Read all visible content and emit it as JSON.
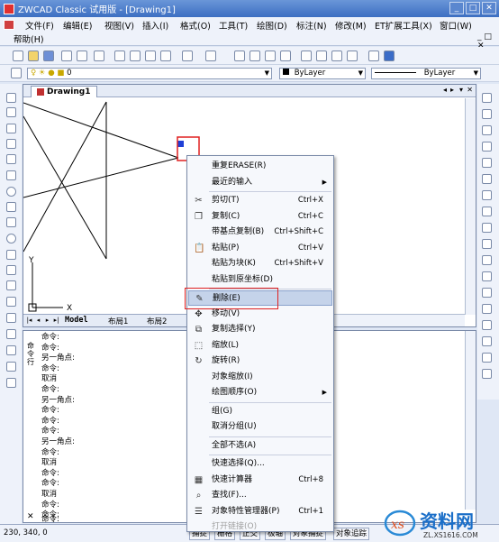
{
  "window": {
    "title": "ZWCAD Classic 试用版 - [Drawing1]"
  },
  "menu": {
    "row1": [
      "文件(F)",
      "编辑(E)",
      "视图(V)",
      "插入(I)",
      "格式(O)",
      "工具(T)",
      "绘图(D)",
      "标注(N)",
      "修改(M)",
      "ET扩展工具(X)",
      "窗口(W)"
    ],
    "row2": [
      "帮助(H)"
    ]
  },
  "properties": {
    "layer_value": "0",
    "color_value": "ByLayer",
    "linetype_value": "ByLayer"
  },
  "document": {
    "tab_label": "Drawing1",
    "tab_controls": [
      "◂",
      "▸",
      "▾",
      "✕"
    ]
  },
  "ucs": {
    "x_label": "X",
    "y_label": "Y"
  },
  "layout_tabs": [
    "Model",
    "布局1",
    "布局2"
  ],
  "command": {
    "side_label": "命令行",
    "history": [
      "命令:",
      "命令:",
      "另一角点:",
      "命令:",
      "取消",
      "命令:",
      "另一角点:",
      "命令:",
      "命令:",
      "命令:",
      "另一角点:",
      "命令:",
      "取消",
      "命令:",
      "命令:",
      "取消",
      "命令:",
      "命令:"
    ],
    "prompt": "命令:",
    "close_glyph": "✕"
  },
  "status": {
    "coords": "230, 340, 0",
    "buttons": [
      "捕捉",
      "栅格",
      "正交",
      "极轴",
      "对象捕捉",
      "对象追踪"
    ]
  },
  "context_menu": {
    "items": [
      {
        "label": "重复ERASE(R)",
        "shortcut": "",
        "icon": "",
        "submenu": false,
        "disabled": false,
        "highlight": false
      },
      {
        "label": "最近的输入",
        "shortcut": "",
        "icon": "",
        "submenu": true,
        "disabled": false,
        "highlight": false
      },
      {
        "sep": true
      },
      {
        "label": "剪切(T)",
        "shortcut": "Ctrl+X",
        "icon": "scissors-icon",
        "submenu": false,
        "disabled": false,
        "highlight": false
      },
      {
        "label": "复制(C)",
        "shortcut": "Ctrl+C",
        "icon": "copy-icon",
        "submenu": false,
        "disabled": false,
        "highlight": false
      },
      {
        "label": "带基点复制(B)",
        "shortcut": "Ctrl+Shift+C",
        "icon": "",
        "submenu": false,
        "disabled": false,
        "highlight": false
      },
      {
        "label": "粘贴(P)",
        "shortcut": "Ctrl+V",
        "icon": "paste-icon",
        "submenu": false,
        "disabled": false,
        "highlight": false
      },
      {
        "label": "粘贴为块(K)",
        "shortcut": "Ctrl+Shift+V",
        "icon": "",
        "submenu": false,
        "disabled": false,
        "highlight": false
      },
      {
        "label": "粘贴到原坐标(D)",
        "shortcut": "",
        "icon": "",
        "submenu": false,
        "disabled": false,
        "highlight": false
      },
      {
        "sep": true
      },
      {
        "label": "删除(E)",
        "shortcut": "",
        "icon": "eraser-icon",
        "submenu": false,
        "disabled": false,
        "highlight": true
      },
      {
        "label": "移动(V)",
        "shortcut": "",
        "icon": "move-icon",
        "submenu": false,
        "disabled": false,
        "highlight": false
      },
      {
        "label": "复制选择(Y)",
        "shortcut": "",
        "icon": "copy-select-icon",
        "submenu": false,
        "disabled": false,
        "highlight": false
      },
      {
        "label": "缩放(L)",
        "shortcut": "",
        "icon": "scale-icon",
        "submenu": false,
        "disabled": false,
        "highlight": false
      },
      {
        "label": "旋转(R)",
        "shortcut": "",
        "icon": "rotate-icon",
        "submenu": false,
        "disabled": false,
        "highlight": false
      },
      {
        "label": "对象缩放(I)",
        "shortcut": "",
        "icon": "",
        "submenu": false,
        "disabled": false,
        "highlight": false
      },
      {
        "label": "绘图顺序(O)",
        "shortcut": "",
        "icon": "",
        "submenu": true,
        "disabled": false,
        "highlight": false
      },
      {
        "sep": true
      },
      {
        "label": "组(G)",
        "shortcut": "",
        "icon": "",
        "submenu": false,
        "disabled": false,
        "highlight": false
      },
      {
        "label": "取消分组(U)",
        "shortcut": "",
        "icon": "",
        "submenu": false,
        "disabled": false,
        "highlight": false
      },
      {
        "sep": true
      },
      {
        "label": "全部不选(A)",
        "shortcut": "",
        "icon": "",
        "submenu": false,
        "disabled": false,
        "highlight": false
      },
      {
        "sep": true
      },
      {
        "label": "快速选择(Q)...",
        "shortcut": "",
        "icon": "",
        "submenu": false,
        "disabled": false,
        "highlight": false
      },
      {
        "label": "快速计算器",
        "shortcut": "Ctrl+8",
        "icon": "calculator-icon",
        "submenu": false,
        "disabled": false,
        "highlight": false
      },
      {
        "label": "查找(F)...",
        "shortcut": "",
        "icon": "find-icon",
        "submenu": false,
        "disabled": false,
        "highlight": false
      },
      {
        "label": "对象特性管理器(P)",
        "shortcut": "Ctrl+1",
        "icon": "properties-icon",
        "submenu": false,
        "disabled": false,
        "highlight": false
      },
      {
        "label": "打开链接(O)",
        "shortcut": "",
        "icon": "",
        "submenu": false,
        "disabled": true,
        "highlight": false
      }
    ]
  },
  "watermark": {
    "brand": "资料网",
    "url": "ZL.XS1616.COM"
  },
  "colors": {
    "title_bar": "#3c6fc2",
    "highlight_box": "#e02020",
    "selected_grip": "#1f3fd6"
  }
}
